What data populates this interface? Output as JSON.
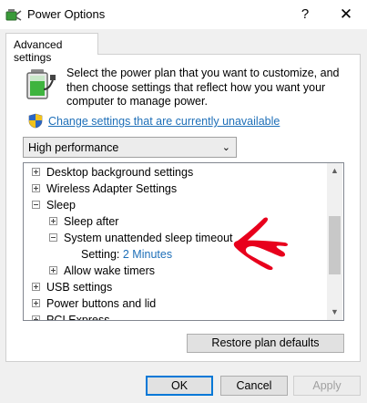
{
  "window": {
    "title": "Power Options",
    "help_glyph": "?",
    "close_glyph": "✕"
  },
  "tabs": [
    {
      "label": "Advanced settings",
      "active": true
    }
  ],
  "intro_text": "Select the power plan that you want to customize, and then choose settings that reflect how you want your computer to manage power.",
  "change_settings_link": "Change settings that are currently unavailable",
  "plan_select": {
    "value": "High performance"
  },
  "tree": {
    "items": [
      {
        "label": "Desktop background settings",
        "expander": "plus"
      },
      {
        "label": "Wireless Adapter Settings",
        "expander": "plus"
      },
      {
        "label": "Sleep",
        "expander": "minus"
      },
      {
        "label": "Sleep after",
        "expander": "plus"
      },
      {
        "label": "System unattended sleep timeout",
        "expander": "minus"
      },
      {
        "label": "Setting:",
        "value": "2 Minutes"
      },
      {
        "label": "Allow wake timers",
        "expander": "plus"
      },
      {
        "label": "USB settings",
        "expander": "plus"
      },
      {
        "label": "Power buttons and lid",
        "expander": "plus"
      },
      {
        "label": "PCI Express",
        "expander": "plus"
      }
    ]
  },
  "restore_button": "Restore plan defaults",
  "buttons": {
    "ok": "OK",
    "cancel": "Cancel",
    "apply": "Apply"
  },
  "colors": {
    "link": "#1e6fb8",
    "annotation_arrow": "#e8001c",
    "focus_border": "#0078d7"
  },
  "icons": [
    "power-options-app-icon",
    "battery-power-icon",
    "uac-shield-icon",
    "chevron-down-icon",
    "red-annotation-arrow"
  ]
}
